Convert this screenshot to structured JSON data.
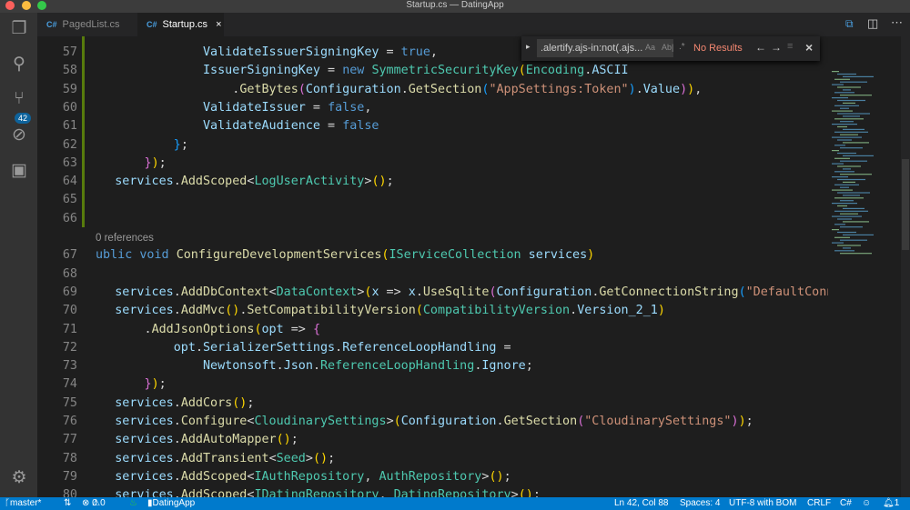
{
  "window": {
    "title": "Startup.cs — DatingApp"
  },
  "activity_bar": {
    "scm_badge": "42",
    "icons": [
      "files-icon",
      "search-icon",
      "source-control-icon",
      "debug-icon",
      "extensions-icon",
      "gear-icon"
    ]
  },
  "tabs": [
    {
      "lang": "C#",
      "label": "PagedList.cs",
      "active": false
    },
    {
      "lang": "C#",
      "label": "Startup.cs",
      "active": true,
      "close": "×"
    }
  ],
  "find_widget": {
    "query": ".alertify.ajs-in:not(.ajs...",
    "match_case": "Aa",
    "whole_word": "Ab|",
    "regex": ".*",
    "result": "No Results",
    "result_color": "#f48771",
    "prev": "←",
    "next": "→",
    "close": "×"
  },
  "codelens": "0 references",
  "code_lines": [
    {
      "n": "57",
      "tokens": [
        [
          "                ",
          "p"
        ],
        [
          "ValidateIssuerSigningKey",
          "v"
        ],
        [
          " = ",
          "p"
        ],
        [
          "true",
          "k"
        ],
        [
          ",",
          "p"
        ]
      ]
    },
    {
      "n": "58",
      "tokens": [
        [
          "                ",
          "p"
        ],
        [
          "IssuerSigningKey",
          "v"
        ],
        [
          " = ",
          "p"
        ],
        [
          "new ",
          "k"
        ],
        [
          "SymmetricSecurityKey",
          "t"
        ],
        [
          "(",
          "b1"
        ],
        [
          "Encoding",
          "t"
        ],
        [
          ".",
          "p"
        ],
        [
          "ASCII",
          "v"
        ]
      ]
    },
    {
      "n": "59",
      "tokens": [
        [
          "                    .",
          "p"
        ],
        [
          "GetBytes",
          "m"
        ],
        [
          "(",
          "b2"
        ],
        [
          "Configuration",
          "v"
        ],
        [
          ".",
          "p"
        ],
        [
          "GetSection",
          "m"
        ],
        [
          "(",
          "b3"
        ],
        [
          "\"AppSettings:Token\"",
          "s"
        ],
        [
          ")",
          "b3"
        ],
        [
          ".",
          "p"
        ],
        [
          "Value",
          "v"
        ],
        [
          ")",
          "b2"
        ],
        [
          ")",
          "b1"
        ],
        [
          ",",
          "p"
        ]
      ]
    },
    {
      "n": "60",
      "tokens": [
        [
          "                ",
          "p"
        ],
        [
          "ValidateIssuer",
          "v"
        ],
        [
          " = ",
          "p"
        ],
        [
          "false",
          "k"
        ],
        [
          ",",
          "p"
        ]
      ]
    },
    {
      "n": "61",
      "tokens": [
        [
          "                ",
          "p"
        ],
        [
          "ValidateAudience",
          "v"
        ],
        [
          " = ",
          "p"
        ],
        [
          "false",
          "k"
        ]
      ]
    },
    {
      "n": "62",
      "tokens": [
        [
          "            ",
          "p"
        ],
        [
          "}",
          "b3"
        ],
        [
          ";",
          "p"
        ]
      ]
    },
    {
      "n": "63",
      "tokens": [
        [
          "        ",
          "p"
        ],
        [
          "}",
          "b2"
        ],
        [
          ")",
          "b1"
        ],
        [
          ";",
          "p"
        ]
      ]
    },
    {
      "n": "64",
      "tokens": [
        [
          "    ",
          "p"
        ],
        [
          "services",
          "v"
        ],
        [
          ".",
          "p"
        ],
        [
          "AddScoped",
          "m"
        ],
        [
          "<",
          "p"
        ],
        [
          "LogUserActivity",
          "t"
        ],
        [
          ">",
          "p"
        ],
        [
          "()",
          "b1"
        ],
        [
          ";",
          "p"
        ]
      ]
    },
    {
      "n": "65",
      "tokens": []
    },
    {
      "n": "66",
      "tokens": []
    },
    {
      "n": "67",
      "lens": true,
      "tokens": [
        [
          "ublic ",
          "k"
        ],
        [
          "void ",
          "k"
        ],
        [
          "ConfigureDevelopmentServices",
          "m"
        ],
        [
          "(",
          "b1"
        ],
        [
          "IServiceCollection",
          "t"
        ],
        [
          " ",
          "p"
        ],
        [
          "services",
          "v"
        ],
        [
          ")",
          "b1"
        ]
      ]
    },
    {
      "n": "68",
      "tokens": []
    },
    {
      "n": "69",
      "tokens": [
        [
          "    ",
          "p"
        ],
        [
          "services",
          "v"
        ],
        [
          ".",
          "p"
        ],
        [
          "AddDbContext",
          "m"
        ],
        [
          "<",
          "p"
        ],
        [
          "DataContext",
          "t"
        ],
        [
          ">",
          "p"
        ],
        [
          "(",
          "b1"
        ],
        [
          "x",
          "v"
        ],
        [
          " => ",
          "p"
        ],
        [
          "x",
          "v"
        ],
        [
          ".",
          "p"
        ],
        [
          "UseSqlite",
          "m"
        ],
        [
          "(",
          "b2"
        ],
        [
          "Configuration",
          "v"
        ],
        [
          ".",
          "p"
        ],
        [
          "GetConnectionString",
          "m"
        ],
        [
          "(",
          "b3"
        ],
        [
          "\"DefaultConne",
          "s"
        ]
      ]
    },
    {
      "n": "70",
      "tokens": [
        [
          "    ",
          "p"
        ],
        [
          "services",
          "v"
        ],
        [
          ".",
          "p"
        ],
        [
          "AddMvc",
          "m"
        ],
        [
          "()",
          "b1"
        ],
        [
          ".",
          "p"
        ],
        [
          "SetCompatibilityVersion",
          "m"
        ],
        [
          "(",
          "b1"
        ],
        [
          "CompatibilityVersion",
          "t"
        ],
        [
          ".",
          "p"
        ],
        [
          "Version_2_1",
          "v"
        ],
        [
          ")",
          "b1"
        ]
      ]
    },
    {
      "n": "71",
      "tokens": [
        [
          "        .",
          "p"
        ],
        [
          "AddJsonOptions",
          "m"
        ],
        [
          "(",
          "b1"
        ],
        [
          "opt",
          "v"
        ],
        [
          " => ",
          "p"
        ],
        [
          "{",
          "b2"
        ]
      ]
    },
    {
      "n": "72",
      "tokens": [
        [
          "            ",
          "p"
        ],
        [
          "opt",
          "v"
        ],
        [
          ".",
          "p"
        ],
        [
          "SerializerSettings",
          "v"
        ],
        [
          ".",
          "p"
        ],
        [
          "ReferenceLoopHandling",
          "v"
        ],
        [
          " =",
          "p"
        ]
      ]
    },
    {
      "n": "73",
      "tokens": [
        [
          "                ",
          "p"
        ],
        [
          "Newtonsoft",
          "v"
        ],
        [
          ".",
          "p"
        ],
        [
          "Json",
          "v"
        ],
        [
          ".",
          "p"
        ],
        [
          "ReferenceLoopHandling",
          "t"
        ],
        [
          ".",
          "p"
        ],
        [
          "Ignore",
          "v"
        ],
        [
          ";",
          "p"
        ]
      ]
    },
    {
      "n": "74",
      "tokens": [
        [
          "        ",
          "p"
        ],
        [
          "}",
          "b2"
        ],
        [
          ")",
          "b1"
        ],
        [
          ";",
          "p"
        ]
      ]
    },
    {
      "n": "75",
      "tokens": [
        [
          "    ",
          "p"
        ],
        [
          "services",
          "v"
        ],
        [
          ".",
          "p"
        ],
        [
          "AddCors",
          "m"
        ],
        [
          "()",
          "b1"
        ],
        [
          ";",
          "p"
        ]
      ]
    },
    {
      "n": "76",
      "tokens": [
        [
          "    ",
          "p"
        ],
        [
          "services",
          "v"
        ],
        [
          ".",
          "p"
        ],
        [
          "Configure",
          "m"
        ],
        [
          "<",
          "p"
        ],
        [
          "CloudinarySettings",
          "t"
        ],
        [
          ">",
          "p"
        ],
        [
          "(",
          "b1"
        ],
        [
          "Configuration",
          "v"
        ],
        [
          ".",
          "p"
        ],
        [
          "GetSection",
          "m"
        ],
        [
          "(",
          "b2"
        ],
        [
          "\"CloudinarySettings\"",
          "s"
        ],
        [
          ")",
          "b2"
        ],
        [
          ")",
          "b1"
        ],
        [
          ";",
          "p"
        ]
      ]
    },
    {
      "n": "77",
      "tokens": [
        [
          "    ",
          "p"
        ],
        [
          "services",
          "v"
        ],
        [
          ".",
          "p"
        ],
        [
          "AddAutoMapper",
          "m"
        ],
        [
          "()",
          "b1"
        ],
        [
          ";",
          "p"
        ]
      ]
    },
    {
      "n": "78",
      "tokens": [
        [
          "    ",
          "p"
        ],
        [
          "services",
          "v"
        ],
        [
          ".",
          "p"
        ],
        [
          "AddTransient",
          "m"
        ],
        [
          "<",
          "p"
        ],
        [
          "Seed",
          "t"
        ],
        [
          ">",
          "p"
        ],
        [
          "()",
          "b1"
        ],
        [
          ";",
          "p"
        ]
      ]
    },
    {
      "n": "79",
      "tokens": [
        [
          "    ",
          "p"
        ],
        [
          "services",
          "v"
        ],
        [
          ".",
          "p"
        ],
        [
          "AddScoped",
          "m"
        ],
        [
          "<",
          "p"
        ],
        [
          "IAuthRepository",
          "t"
        ],
        [
          ", ",
          "p"
        ],
        [
          "AuthRepository",
          "t"
        ],
        [
          ">",
          "p"
        ],
        [
          "()",
          "b1"
        ],
        [
          ";",
          "p"
        ]
      ]
    },
    {
      "n": "80",
      "tokens": [
        [
          "    ",
          "p"
        ],
        [
          "services",
          "v"
        ],
        [
          ".",
          "p"
        ],
        [
          "AddScoped",
          "m"
        ],
        [
          "<",
          "p"
        ],
        [
          "IDatingRepository",
          "t"
        ],
        [
          ", ",
          "p"
        ],
        [
          "DatingRepository",
          "t"
        ],
        [
          ">",
          "p"
        ],
        [
          "()",
          "b1"
        ],
        [
          ";",
          "p"
        ]
      ]
    }
  ],
  "status_bar": {
    "branch": "master*",
    "sync": "⇅",
    "errors": "0",
    "warnings": "0",
    "project": "DatingApp",
    "position": "Ln 42, Col 88",
    "spaces": "Spaces: 4",
    "encoding": "UTF-8 with BOM",
    "eol": "CRLF",
    "language": "C#",
    "notifications": "1",
    "color": "#007acc"
  }
}
